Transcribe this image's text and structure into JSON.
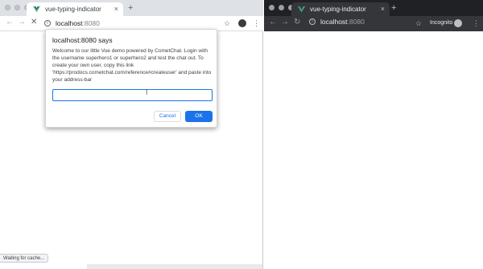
{
  "left_window": {
    "tab_title": "vue-typing-indicator",
    "tab_close": "×",
    "new_tab": "+",
    "nav": {
      "back": "←",
      "forward": "→",
      "stop": "✕"
    },
    "url_host": "localhost",
    "url_port": ":8080",
    "info_glyph": "i",
    "star": "☆",
    "menu": "⋮",
    "status_text": "Waiting for cache...",
    "dialog": {
      "title": "localhost:8080 says",
      "message": "Welcome to our little Vue demo powered by CometChat. Login with the username superhero1 or superhero2 and test the chat out. To create your own user, copy this link 'https://prodocs.cometchat.com/reference#createuser' and paste into your address-bar",
      "input_value": "",
      "cursor": "I",
      "cancel_label": "Cancel",
      "ok_label": "OK"
    }
  },
  "right_window": {
    "tab_title": "vue-typing-indicator",
    "tab_close": "×",
    "new_tab": "+",
    "nav": {
      "back": "←",
      "forward": "→",
      "reload": "↻"
    },
    "url_host": "localhost",
    "url_port": ":8080",
    "info_glyph": "i",
    "star": "☆",
    "incognito_label": "Incognito",
    "menu": "⋮"
  },
  "colors": {
    "accent_blue": "#1a73e8",
    "vue_green": "#41b883",
    "dark_frame": "#202124"
  }
}
